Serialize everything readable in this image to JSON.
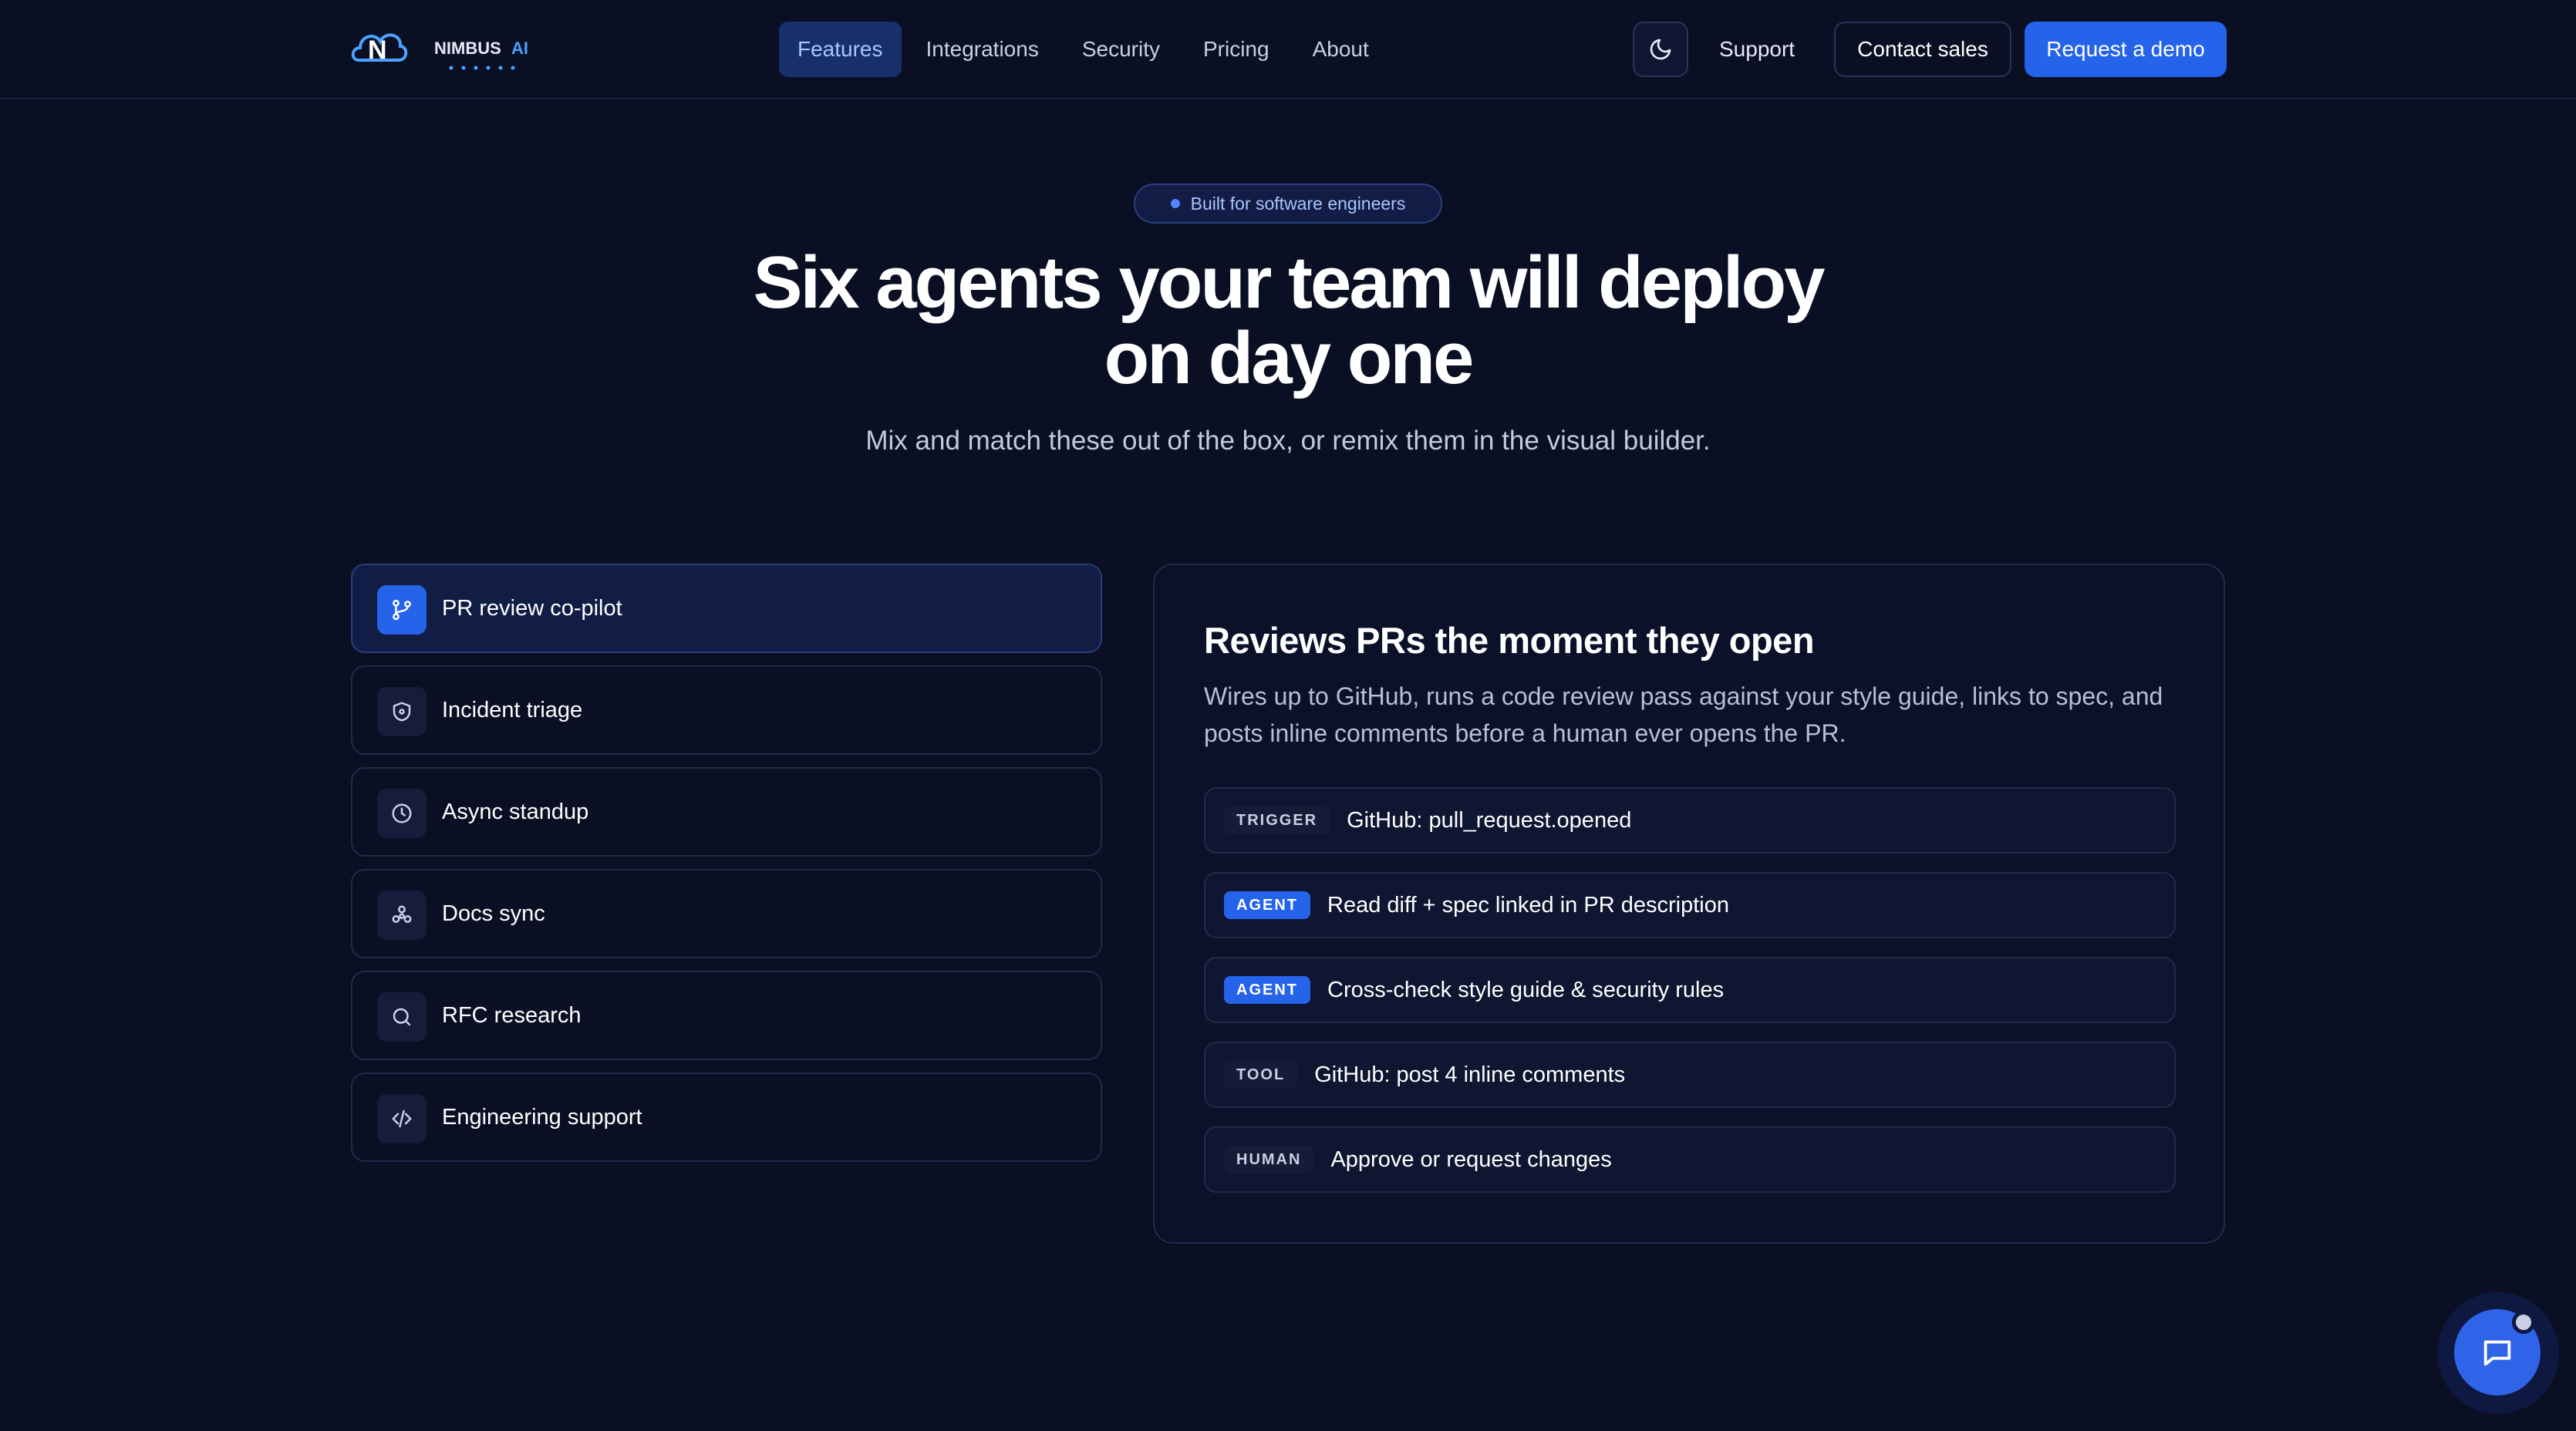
{
  "brand": {
    "name": "NIMBUS AI"
  },
  "nav": {
    "links": [
      {
        "label": "Features",
        "active": true
      },
      {
        "label": "Integrations"
      },
      {
        "label": "Security"
      },
      {
        "label": "Pricing"
      },
      {
        "label": "About"
      }
    ],
    "theme_toggle_icon": "moon-icon",
    "support": "Support",
    "contact": "Contact sales",
    "demo": "Request a demo"
  },
  "hero": {
    "badge": "Built for software engineers",
    "title_line1": "Six agents your team will deploy",
    "title_line2": "on day one",
    "subtitle": "Mix and match these out of the box, or remix them in the visual builder."
  },
  "agents": [
    {
      "label": "PR review co-pilot",
      "icon": "git-branch-icon",
      "active": true
    },
    {
      "label": "Incident triage",
      "icon": "shield-icon"
    },
    {
      "label": "Async standup",
      "icon": "clock-icon"
    },
    {
      "label": "Docs sync",
      "icon": "cluster-icon"
    },
    {
      "label": "RFC research",
      "icon": "search-icon"
    },
    {
      "label": "Engineering support",
      "icon": "code-icon"
    }
  ],
  "panel": {
    "title": "Reviews PRs the moment they open",
    "description": "Wires up to GitHub, runs a code review pass against your style guide, links to spec, and posts inline comments before a human ever opens the PR.",
    "steps": [
      {
        "tag": "TRIGGER",
        "text": "GitHub: pull_request.opened"
      },
      {
        "tag": "AGENT",
        "text": "Read diff + spec linked in PR description"
      },
      {
        "tag": "AGENT",
        "text": "Cross-check style guide & security rules"
      },
      {
        "tag": "TOOL",
        "text": "GitHub: post 4 inline comments"
      },
      {
        "tag": "HUMAN",
        "text": "Approve or request changes"
      }
    ]
  },
  "chat": {
    "icon": "chat-bubble-icon"
  },
  "colors": {
    "background": "#0a0f24",
    "accent": "#2563eb",
    "active_nav": "#17306b"
  }
}
